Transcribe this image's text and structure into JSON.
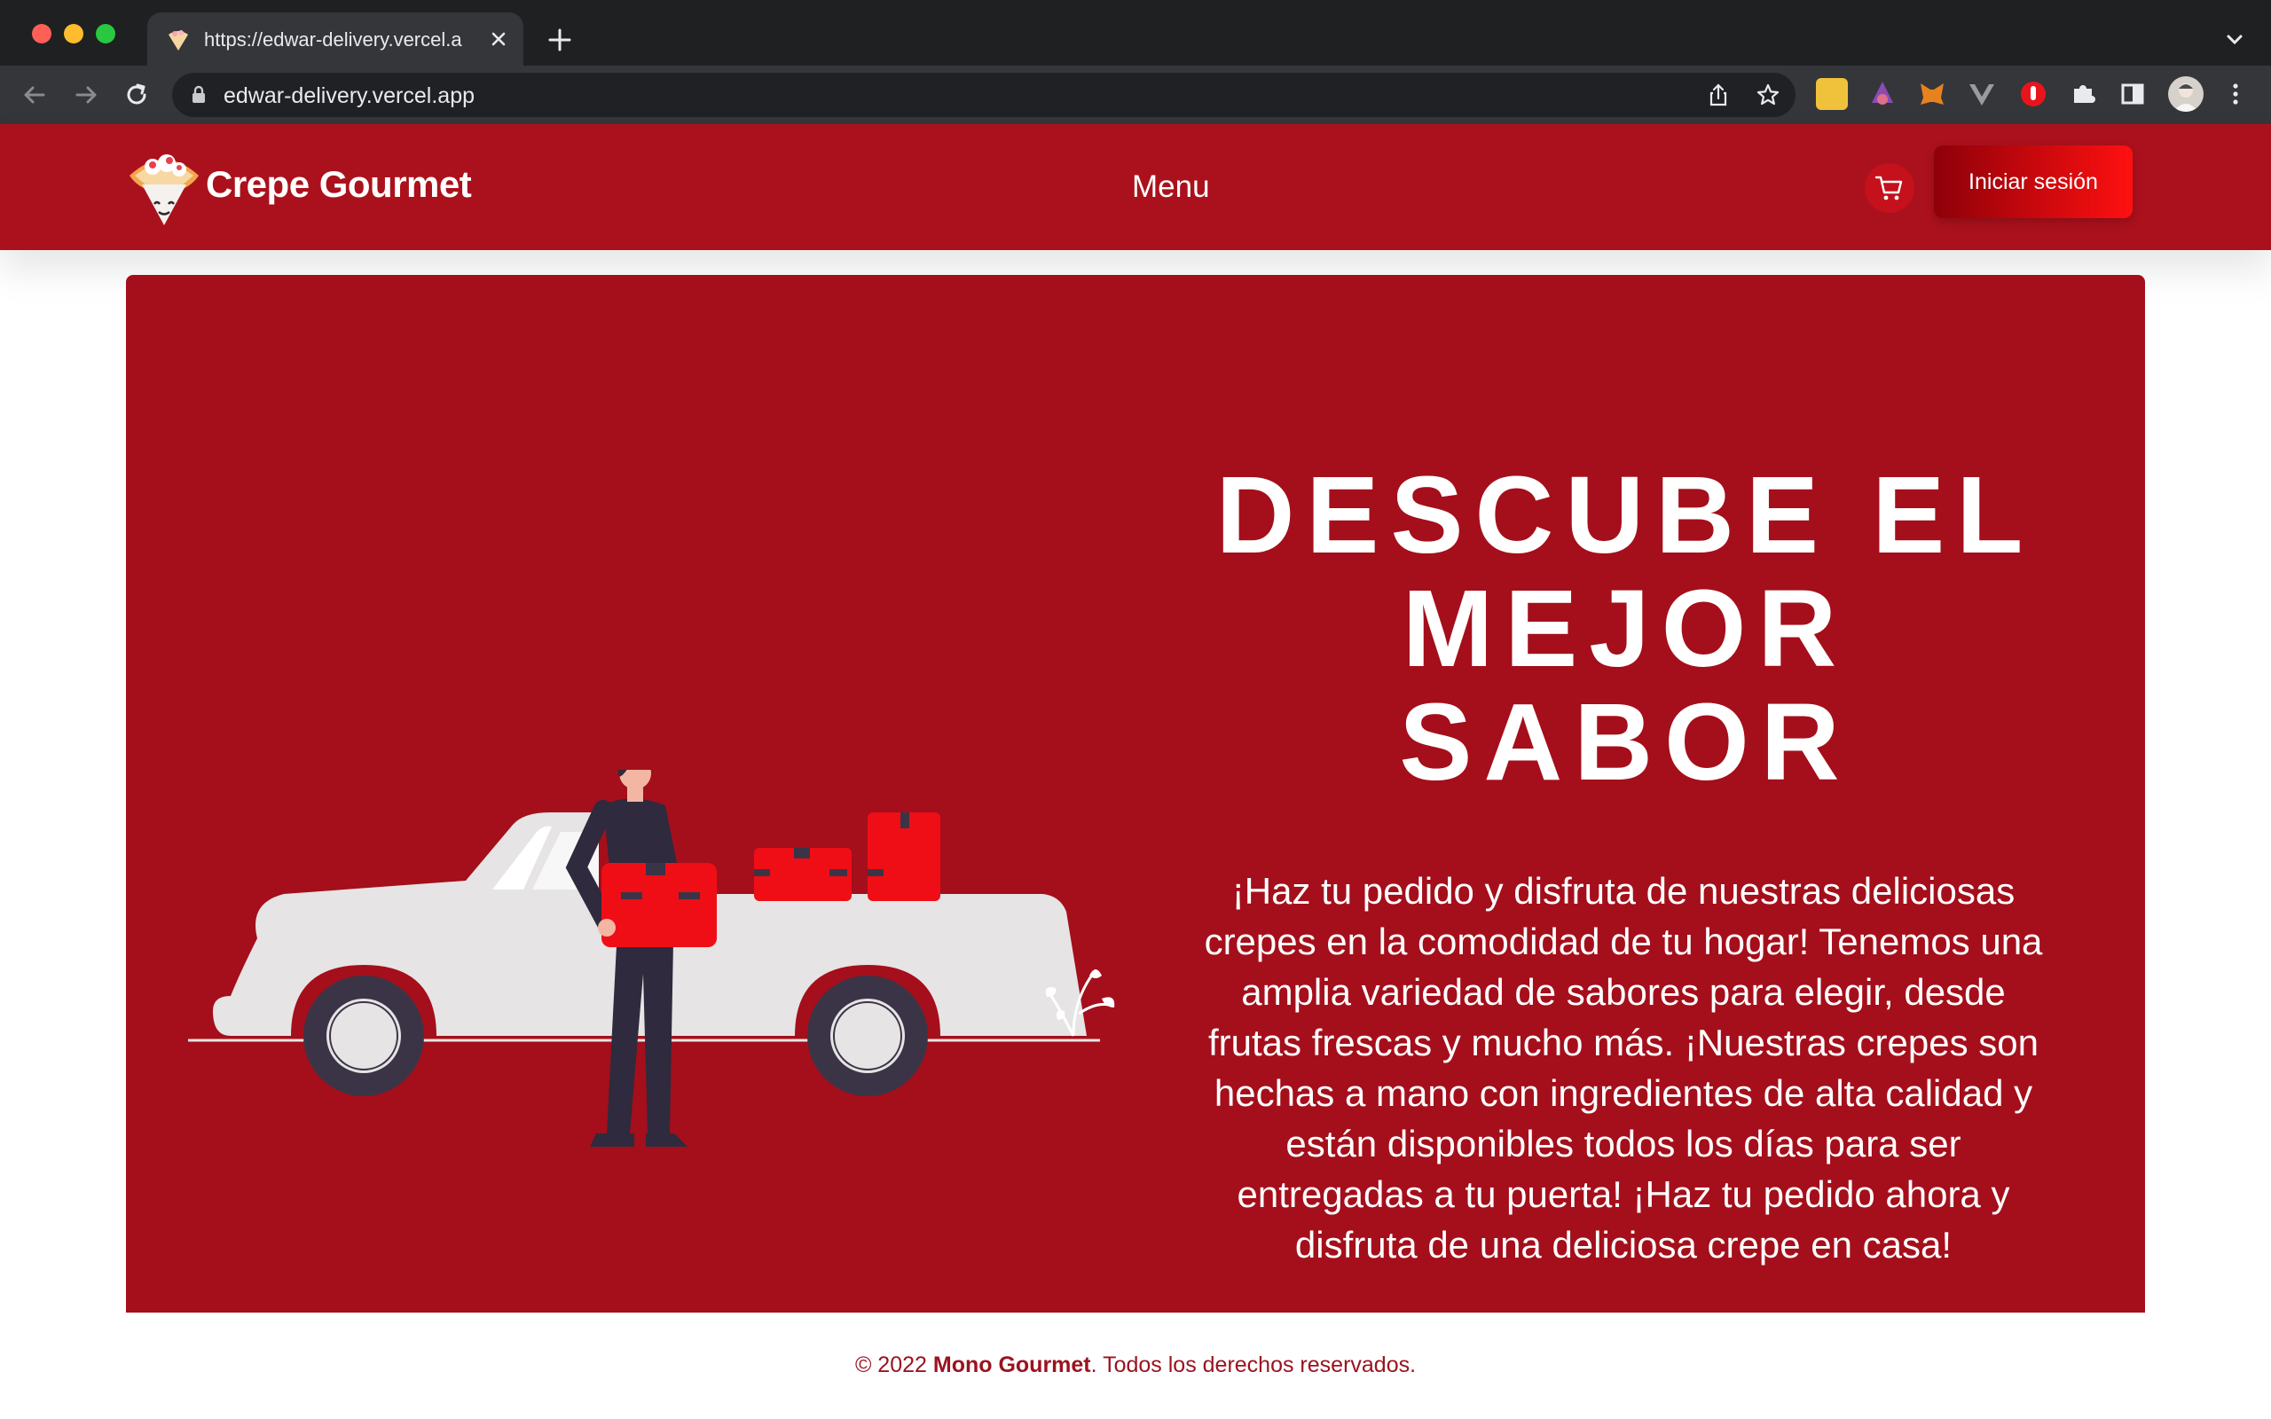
{
  "browser": {
    "tab_title": "https://edwar-delivery.vercel.a",
    "url": "edwar-delivery.vercel.app",
    "icons": [
      "back-arrow-icon",
      "forward-arrow-icon",
      "reload-icon",
      "lock-icon",
      "share-icon",
      "star-icon",
      "puzzle-icon",
      "sidepanel-icon",
      "kebab-menu-icon"
    ]
  },
  "header": {
    "brand": "Crepe Gourmet",
    "nav_menu": "Menu",
    "login_label": "Iniciar sesión",
    "cart_icon": "cart-icon"
  },
  "hero": {
    "title": "DESCUBE EL MEJOR SABOR",
    "description": "¡Haz tu pedido y disfruta de nuestras deliciosas crepes en la comodidad de tu hogar! Tenemos una amplia variedad de sabores para elegir, desde frutas frescas y mucho más. ¡Nuestras crepes son hechas a mano con ingredientes de alta calidad y están disponibles todos los días para ser entregadas a tu puerta! ¡Haz tu pedido ahora y disfruta de una deliciosa crepe en casa!"
  },
  "footer": {
    "prefix": "© 2022 ",
    "brand": "Mono Gourmet",
    "suffix": ". Todos los derechos reservados."
  },
  "colors": {
    "header_bg": "#ab111c",
    "hero_bg": "#a40f1b",
    "login_gradient_start": "#8e0009",
    "login_gradient_end": "#ff1010",
    "footer_text": "#9b1320"
  }
}
